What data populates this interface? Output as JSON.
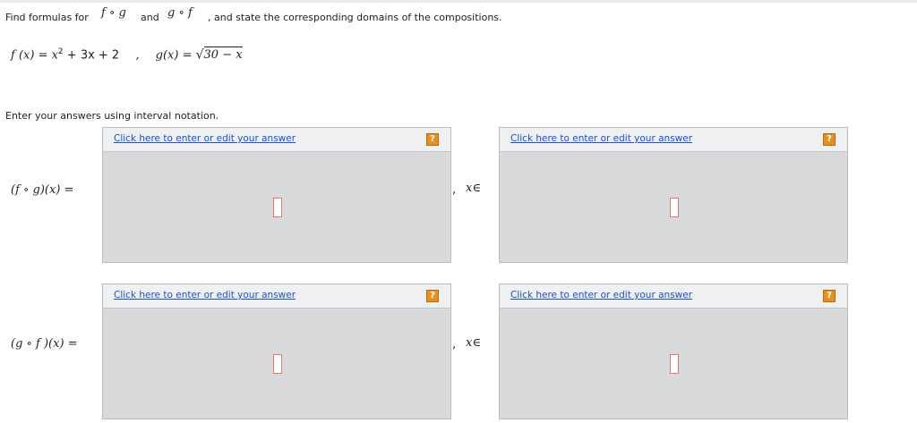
{
  "question": {
    "prefix": "Find formulas for",
    "fog": "f ∘ g",
    "and": "and",
    "gof": "g ∘ f",
    "suffix": ", and state the corresponding domains of the compositions."
  },
  "functions": {
    "f_lhs": "f (x) = x",
    "f_exp": "2",
    "f_rhs": " + 3x + 2",
    "separator": ",",
    "g_lhs": "g(x) = ",
    "g_radical": "√",
    "g_radicand": "30 − x"
  },
  "instructions": "Enter your answers using interval notation.",
  "answers": [
    {
      "label": "(f ∘ g)(x) =",
      "comma": ",",
      "domain_label": "x∈",
      "formula_link": "Click here to enter or edit your answer",
      "domain_link": "Click here to enter or edit your answer",
      "help": "?"
    },
    {
      "label": "(g ∘ f )(x) =",
      "comma": ",",
      "domain_label": "x∈",
      "formula_link": "Click here to enter or edit your answer",
      "domain_link": "Click here to enter or edit your answer",
      "help": "?"
    }
  ]
}
